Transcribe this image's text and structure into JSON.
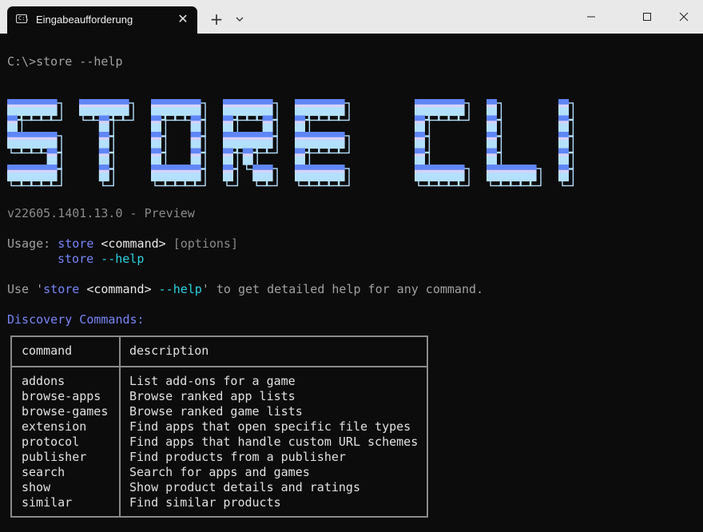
{
  "window": {
    "tab_title": "Eingabeaufforderung",
    "tab_icon": "terminal-icon",
    "close_tab_symbol": "✕",
    "new_tab_symbol": "+"
  },
  "terminal": {
    "prompt_line": "C:\\>store --help",
    "banner_text": "STORE CLI",
    "version": "v22605.1401.13.0 - Preview",
    "usage": {
      "label": "Usage: ",
      "store": "store",
      "command": " <command>",
      "options": " [options]",
      "store2": "store",
      "help": " --help"
    },
    "use_line": {
      "prefix": "Use '",
      "store": "store",
      "command": " <command>",
      "help": " --help",
      "suffix": "' to get detailed help for any command."
    },
    "section_title": "Discovery Commands:",
    "table": {
      "headers": [
        "command",
        "description"
      ],
      "rows": [
        {
          "command": "addons",
          "description": "List add-ons for a game"
        },
        {
          "command": "browse-apps",
          "description": "Browse ranked app lists"
        },
        {
          "command": "browse-games",
          "description": "Browse ranked game lists"
        },
        {
          "command": "extension",
          "description": "Find apps that open specific file types"
        },
        {
          "command": "protocol",
          "description": "Find apps that handle custom URL schemes"
        },
        {
          "command": "publisher",
          "description": "Find products from a publisher"
        },
        {
          "command": "search",
          "description": "Search for apps and games"
        },
        {
          "command": "show",
          "description": "Show product details and ratings"
        },
        {
          "command": "similar",
          "description": "Find similar products"
        }
      ]
    }
  },
  "colors": {
    "background": "#0c0c0c",
    "titlebar": "#e9e9e9",
    "accent_blue": "#7785f5",
    "accent_cyan": "#2ed0e0",
    "banner_top": "#5f86f5",
    "banner_mid": "#d6d2fa",
    "banner_bottom": "#b3e0ff"
  }
}
